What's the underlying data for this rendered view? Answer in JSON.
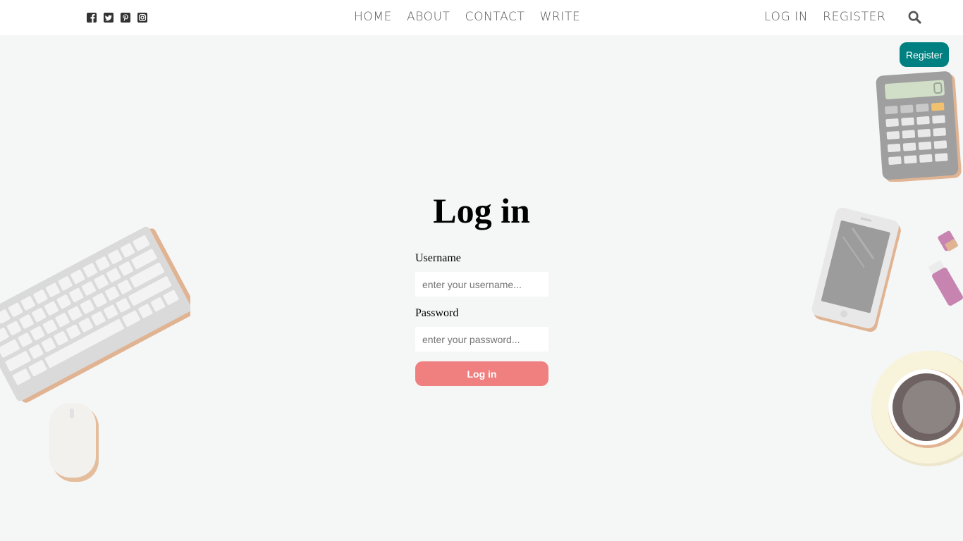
{
  "social": [
    {
      "icon": "facebook-square-icon"
    },
    {
      "icon": "twitter-square-icon"
    },
    {
      "icon": "pinterest-square-icon"
    },
    {
      "icon": "instagram-square-icon"
    }
  ],
  "nav": {
    "center": [
      "HOME",
      "ABOUT",
      "CONTACT",
      "WRITE"
    ],
    "right": [
      "LOG IN",
      "REGISTER"
    ],
    "search_icon": "search-icon"
  },
  "register_button": "Register",
  "login": {
    "title": "Log in",
    "username_label": "Username",
    "username_placeholder": "enter your username...",
    "password_label": "Password",
    "password_placeholder": "enter your password...",
    "submit": "Log in"
  },
  "colors": {
    "background": "#f5f6f6",
    "topbar": "#ffffff",
    "register_button": "#008080",
    "login_button": "#f08080"
  }
}
